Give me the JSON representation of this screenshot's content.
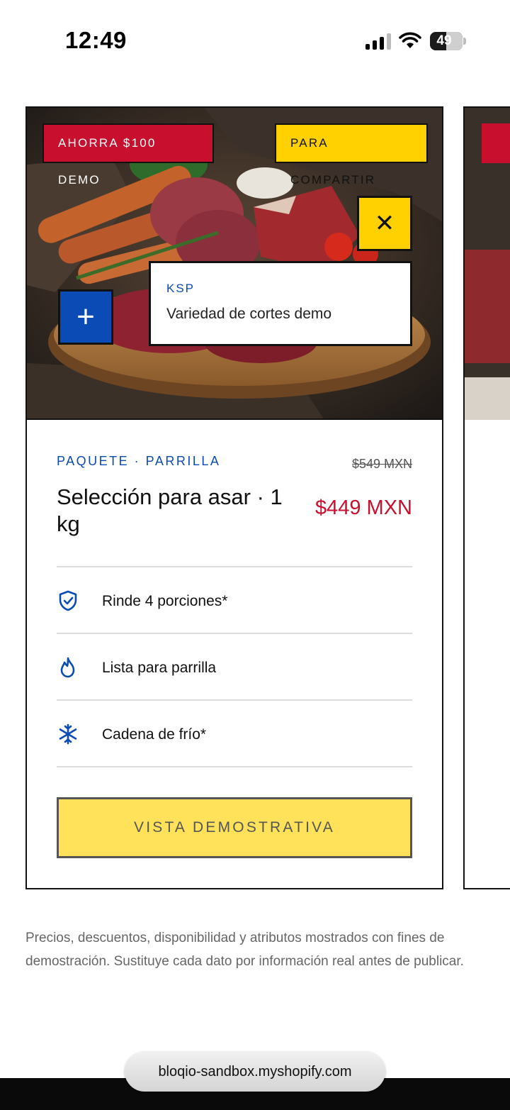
{
  "status_bar": {
    "time": "12:49",
    "battery_level": "49",
    "icons": [
      "signal-icon",
      "wifi-icon",
      "battery-icon"
    ]
  },
  "product_card": {
    "badges": {
      "discount": "AHORRA $100 DEMO",
      "share": "PARA COMPARTIR"
    },
    "close_icon": "close-icon",
    "plus_icon": "plus-icon",
    "tooltip": {
      "brand": "KSP",
      "text": "Variedad de cortes demo"
    },
    "category": "PAQUETE · PARRILLA",
    "old_price": "$549 MXN",
    "title": "Selección para asar · 1 kg",
    "price": "$449 MXN",
    "features": [
      {
        "icon": "shield-check-icon",
        "label": "Rinde 4 porciones*"
      },
      {
        "icon": "flame-icon",
        "label": "Lista para parrilla"
      },
      {
        "icon": "snowflake-icon",
        "label": "Cadena de frío*"
      }
    ],
    "cta_label": "VISTA DEMOSTRATIVA"
  },
  "disclaimer": "Precios, descuentos, disponibilidad y atributos mostrados con fines de demostración. Sustituye cada dato por información real antes de publicar.",
  "browser": {
    "url": "bloqio-sandbox.myshopify.com"
  },
  "colors": {
    "brand_blue": "#0b4bb5",
    "sale_red": "#c8102e",
    "accent_yellow": "#ffd100",
    "cta_yellow": "#ffe15a"
  }
}
